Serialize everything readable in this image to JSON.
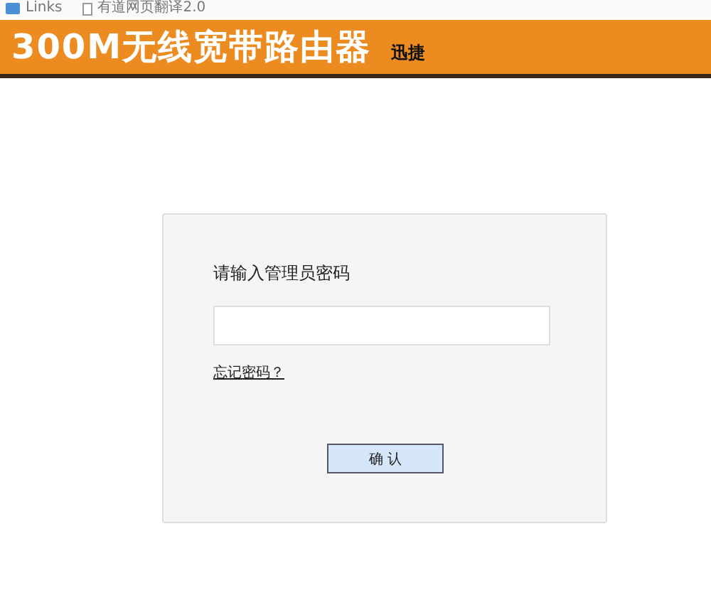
{
  "bookmarks_bar": {
    "items": [
      {
        "label": "Links",
        "kind": "folder"
      },
      {
        "label": "有道网页翻译2.0",
        "kind": "page"
      }
    ]
  },
  "header": {
    "title": "300M无线宽带路由器",
    "brand": "迅捷"
  },
  "login": {
    "prompt": "请输入管理员密码",
    "forgot_link": "忘记密码？",
    "confirm_button": "确 认"
  }
}
